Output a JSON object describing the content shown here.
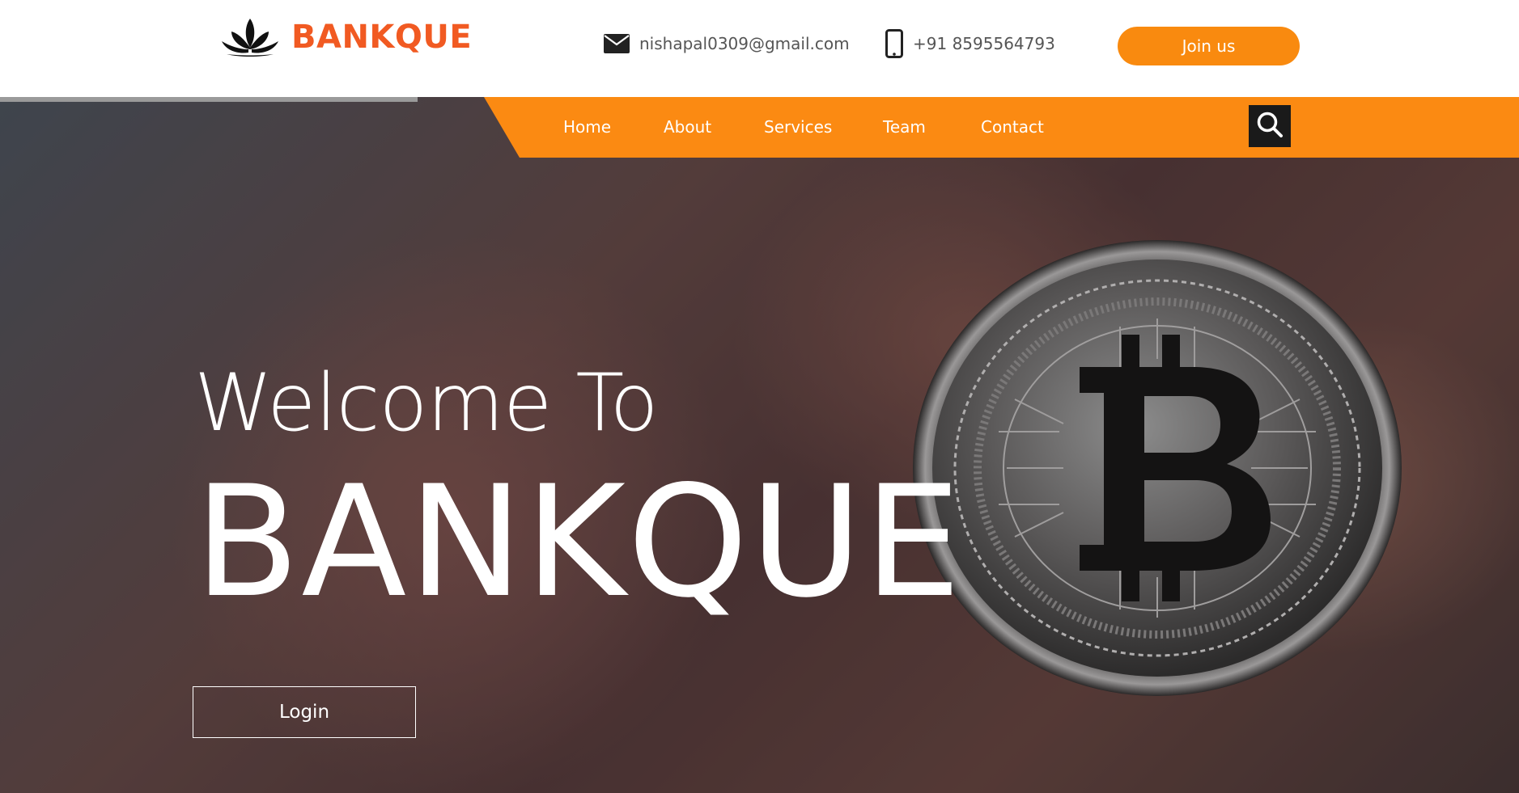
{
  "header": {
    "brand": "BANKQUE",
    "email": "nishapal0309@gmail.com",
    "phone": "+91 8595564793",
    "join_label": "Join us"
  },
  "nav": {
    "items": [
      {
        "label": "Home"
      },
      {
        "label": "About"
      },
      {
        "label": "Services"
      },
      {
        "label": "Team"
      },
      {
        "label": "Contact"
      }
    ],
    "search_icon": "search-icon"
  },
  "hero": {
    "welcome": "Welcome To",
    "brand": "BANKQUE",
    "login_label": "Login"
  },
  "colors": {
    "accent": "#f98a0f",
    "brand": "#f15a22",
    "text_muted": "#555555"
  },
  "icons": {
    "logo": "lotus-logo-icon",
    "email": "envelope-icon",
    "phone": "mobile-phone-icon",
    "coin": "bitcoin-coin-image"
  }
}
